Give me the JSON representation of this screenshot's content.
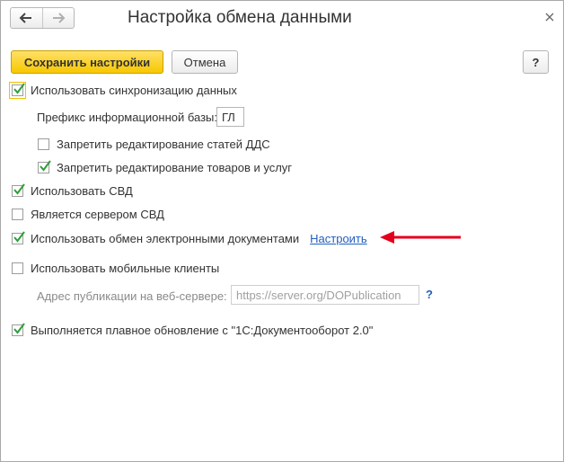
{
  "window": {
    "title": "Настройка обмена данными"
  },
  "toolbar": {
    "save_label": "Сохранить настройки",
    "cancel_label": "Отмена",
    "help_label": "?"
  },
  "options": {
    "use_sync": {
      "label": "Использовать синхронизацию данных",
      "checked": true
    },
    "prefix_label": "Префикс информационной базы:",
    "prefix_value": "ГЛ",
    "forbid_dds": {
      "label": "Запретить редактирование статей ДДС",
      "checked": false
    },
    "forbid_goods": {
      "label": "Запретить редактирование товаров и услуг",
      "checked": true
    },
    "use_svd": {
      "label": "Использовать СВД",
      "checked": true
    },
    "svd_server": {
      "label": "Является сервером СВД",
      "checked": false
    },
    "use_edo": {
      "label": "Использовать обмен электронными документами",
      "checked": true,
      "link": "Настроить"
    },
    "use_mobile": {
      "label": "Использовать мобильные клиенты",
      "checked": false
    },
    "publication_label": "Адрес публикации на веб-сервере:",
    "publication_placeholder": "https://server.org/DOPublication",
    "publication_help": "?",
    "smooth_update": {
      "label": "Выполняется плавное обновление с \"1С:Документооборот 2.0\"",
      "checked": true
    }
  },
  "colors": {
    "primary_button": "#f7c800",
    "check_mark": "#2e9e3a",
    "link": "#1f5fbf",
    "annotation_arrow": "#e3001b"
  },
  "icons": {
    "back": "arrow-left-icon",
    "forward": "arrow-right-icon",
    "close": "close-icon",
    "check": "check-icon",
    "annotation": "red-arrow-icon"
  }
}
